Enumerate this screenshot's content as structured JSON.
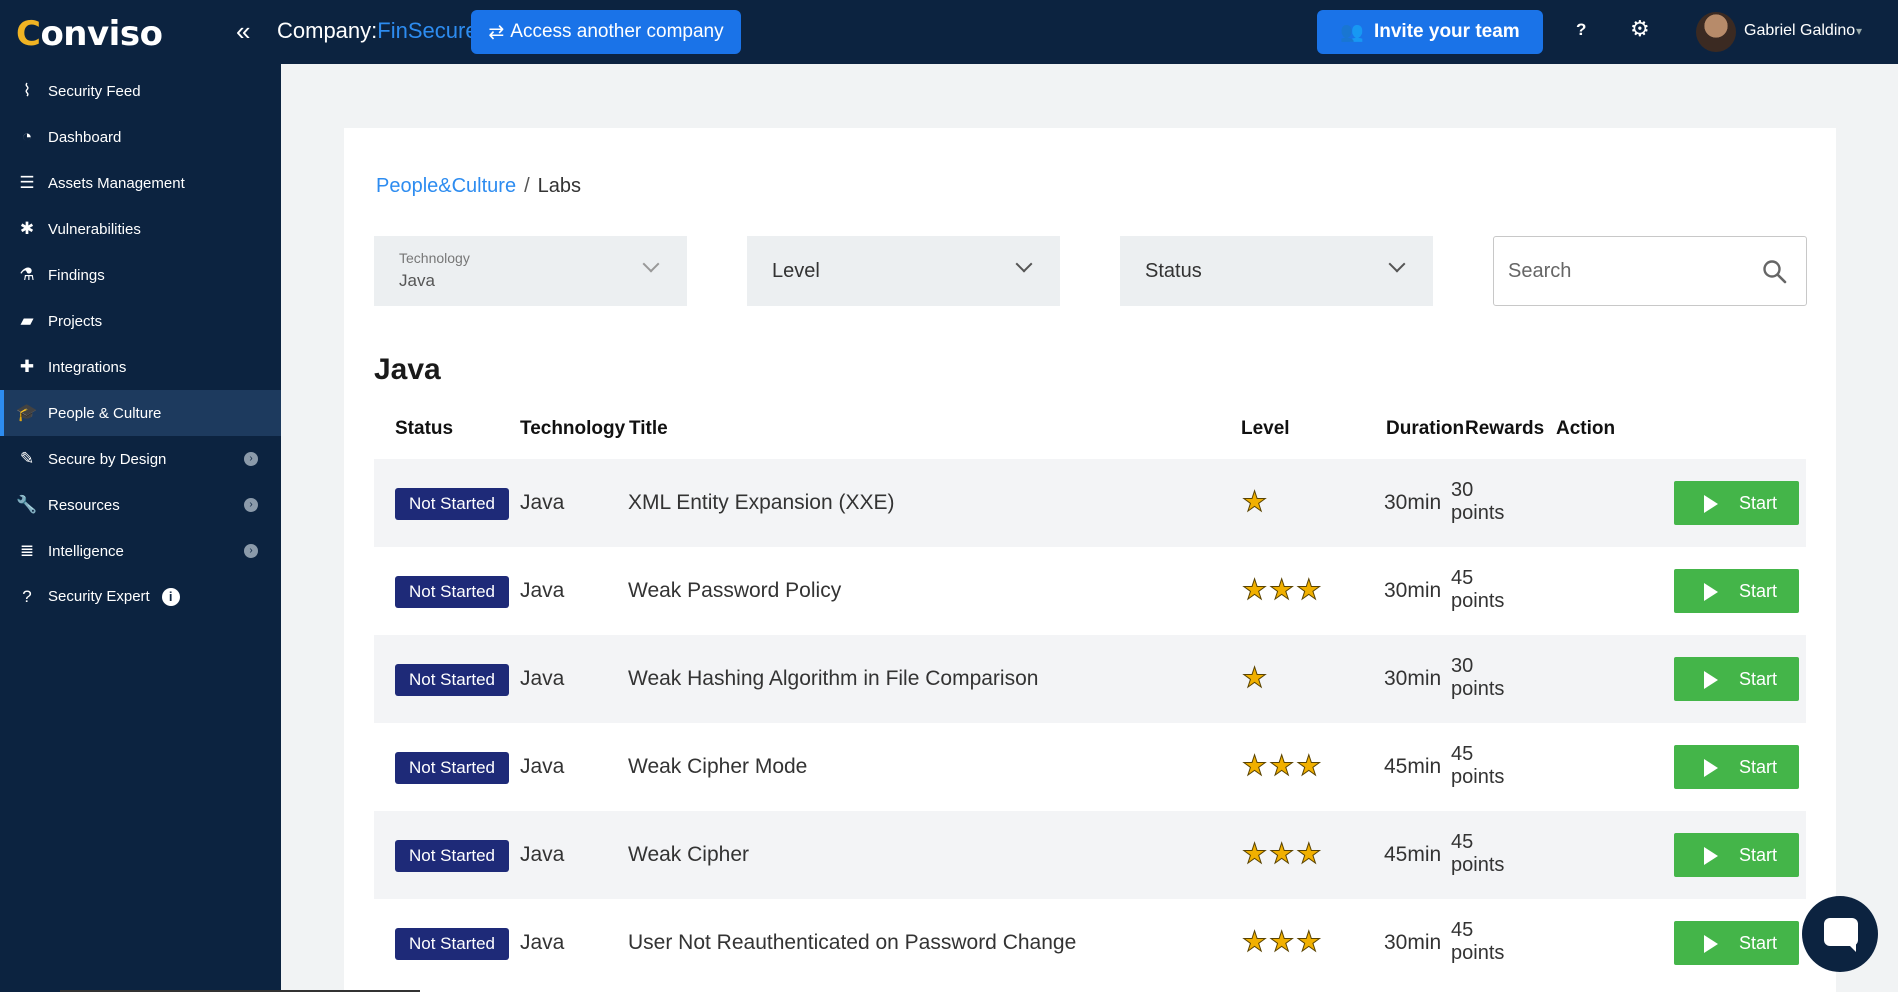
{
  "topbar": {
    "logo_prefix": "C",
    "logo_rest": "onviso",
    "collapse_icon": "«",
    "company_label": "Company:",
    "company_name": "FinSecure",
    "access_label": "Access another company",
    "invite_label": "Invite your team",
    "help_label": "?",
    "gear_icon": "⚙",
    "user_name": "Gabriel Galdino",
    "caret": "▾"
  },
  "sidebar": {
    "items": [
      {
        "label": "Security Feed",
        "icon": "rss-icon",
        "glyph": "⌇"
      },
      {
        "label": "Dashboard",
        "icon": "gauge-icon",
        "glyph": "◔"
      },
      {
        "label": "Assets Management",
        "icon": "server-icon",
        "glyph": "☰"
      },
      {
        "label": "Vulnerabilities",
        "icon": "bug-icon",
        "glyph": "✱"
      },
      {
        "label": "Findings",
        "icon": "flask-icon",
        "glyph": "⚗"
      },
      {
        "label": "Projects",
        "icon": "folder-icon",
        "glyph": "▰"
      },
      {
        "label": "Integrations",
        "icon": "puzzle-icon",
        "glyph": "✚"
      },
      {
        "label": "People & Culture",
        "icon": "graduation-cap-icon",
        "glyph": "🎓"
      },
      {
        "label": "Secure by Design",
        "icon": "pencil-square-icon",
        "glyph": "✎"
      },
      {
        "label": "Resources",
        "icon": "wrench-icon",
        "glyph": "🔧"
      },
      {
        "label": "Intelligence",
        "icon": "database-icon",
        "glyph": "≣"
      },
      {
        "label": "Security Expert",
        "icon": "question-circle-icon",
        "glyph": "?"
      }
    ],
    "submenu_arrow": "›",
    "info_glyph": "i"
  },
  "main": {
    "breadcrumb": {
      "parent": "People&Culture",
      "separator": "/",
      "current": "Labs"
    },
    "filters": {
      "technology_label": "Technology",
      "technology_value": "Java",
      "level_label": "Level",
      "status_label": "Status",
      "search_placeholder": "Search"
    },
    "section_title": "Java",
    "columns": {
      "status": "Status",
      "technology": "Technology",
      "title": "Title",
      "level": "Level",
      "duration": "Duration",
      "rewards": "Rewards",
      "action": "Action"
    },
    "rows": [
      {
        "status": "Not Started",
        "technology": "Java",
        "title": "XML Entity Expansion (XXE)",
        "stars": "★",
        "level": 1,
        "duration": "30min",
        "points": "30",
        "points_unit": "points",
        "action": "Start"
      },
      {
        "status": "Not Started",
        "technology": "Java",
        "title": "Weak Password Policy",
        "stars": "★★★",
        "level": 3,
        "duration": "30min",
        "points": "45",
        "points_unit": "points",
        "action": "Start"
      },
      {
        "status": "Not Started",
        "technology": "Java",
        "title": "Weak Hashing Algorithm in File Comparison",
        "stars": "★",
        "level": 1,
        "duration": "30min",
        "points": "30",
        "points_unit": "points",
        "action": "Start"
      },
      {
        "status": "Not Started",
        "technology": "Java",
        "title": "Weak Cipher Mode",
        "stars": "★★★",
        "level": 3,
        "duration": "45min",
        "points": "45",
        "points_unit": "points",
        "action": "Start"
      },
      {
        "status": "Not Started",
        "technology": "Java",
        "title": "Weak Cipher",
        "stars": "★★★",
        "level": 3,
        "duration": "45min",
        "points": "45",
        "points_unit": "points",
        "action": "Start"
      },
      {
        "status": "Not Started",
        "technology": "Java",
        "title": "User Not Reauthenticated on Password Change",
        "stars": "★★★",
        "level": 3,
        "duration": "30min",
        "points": "45",
        "points_unit": "points",
        "action": "Start"
      }
    ]
  },
  "colors": {
    "navy": "#0c2340",
    "accent_blue": "#1a73e8",
    "badge": "#1e2a78",
    "start_green": "#44b549",
    "star": "#f1b000"
  }
}
